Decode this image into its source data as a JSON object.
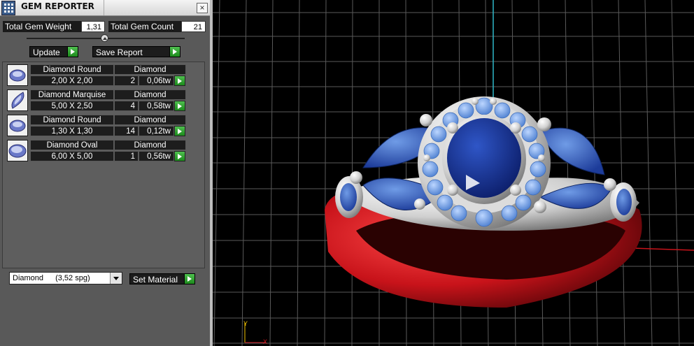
{
  "window": {
    "title": "GEM REPORTER",
    "close_glyph": "×"
  },
  "stats": {
    "total_weight_label": "Total Gem Weight",
    "total_weight_value": "1,31",
    "total_count_label": "Total Gem Count",
    "total_count_value": "21"
  },
  "actions": {
    "update_label": "Update",
    "save_report_label": "Save Report"
  },
  "gems": [
    {
      "name": "Diamond Round",
      "material": "Diamond",
      "size": "2,00 X 2,00",
      "qty": "2",
      "weight": "0,06tw",
      "shape": "round"
    },
    {
      "name": "Diamond Marquise",
      "material": "Diamond",
      "size": "5,00 X 2,50",
      "qty": "4",
      "weight": "0,58tw",
      "shape": "marquise"
    },
    {
      "name": "Diamond Round",
      "material": "Diamond",
      "size": "1,30 X 1,30",
      "qty": "14",
      "weight": "0,12tw",
      "shape": "round"
    },
    {
      "name": "Diamond Oval",
      "material": "Diamond",
      "size": "6,00 X 5,00",
      "qty": "1",
      "weight": "0,56tw",
      "shape": "oval"
    }
  ],
  "material_select": {
    "value": "Diamond",
    "density": "(3,52 spg)"
  },
  "set_material_label": "Set Material",
  "viewport": {
    "axis_y_label": "Y",
    "axis_x_label": "X",
    "colors": {
      "background": "#000000",
      "grid": "#5a5a5a",
      "band": "#c8131a",
      "center_stone": "#1d3a9a",
      "side_stones": "#3d6ac7",
      "halo_stones": "#6f9fe0",
      "metal": "#e6e6e6"
    }
  },
  "colors": {
    "panel": "#595959",
    "accent_green": "#2fa52f"
  }
}
